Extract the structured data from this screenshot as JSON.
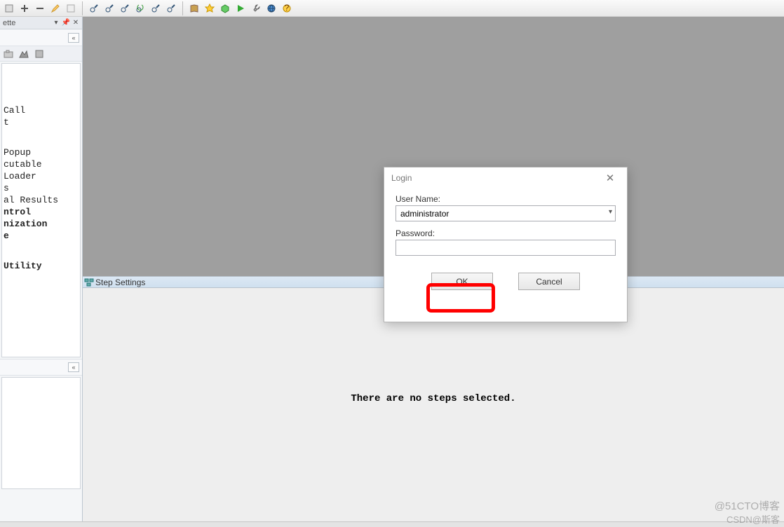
{
  "palette": {
    "title": "ette",
    "items": [
      {
        "label": " Call",
        "bold": false
      },
      {
        "label": "t",
        "bold": false
      },
      {
        "label": "",
        "bold": false,
        "spacer": true
      },
      {
        "label": " Popup",
        "bold": false
      },
      {
        "label": "cutable",
        "bold": false
      },
      {
        "label": " Loader",
        "bold": false
      },
      {
        "label": "s",
        "bold": false
      },
      {
        "label": "al Results",
        "bold": false
      },
      {
        "label": "ntrol",
        "bold": true
      },
      {
        "label": "nization",
        "bold": true
      },
      {
        "label": "e",
        "bold": true
      },
      {
        "label": "",
        "bold": false,
        "spacer": true
      },
      {
        "label": " Utility",
        "bold": true
      }
    ]
  },
  "step_panel": {
    "title": "Step Settings",
    "empty_msg": "There are no steps selected."
  },
  "login_dialog": {
    "title": "Login",
    "user_label": "User Name:",
    "user_value": "administrator",
    "pass_label": "Password:",
    "pass_value": "",
    "ok_label": "OK",
    "cancel_label": "Cancel"
  },
  "watermarks": {
    "w1": "@51CTO博客",
    "w2": "CSDN@斯客"
  }
}
